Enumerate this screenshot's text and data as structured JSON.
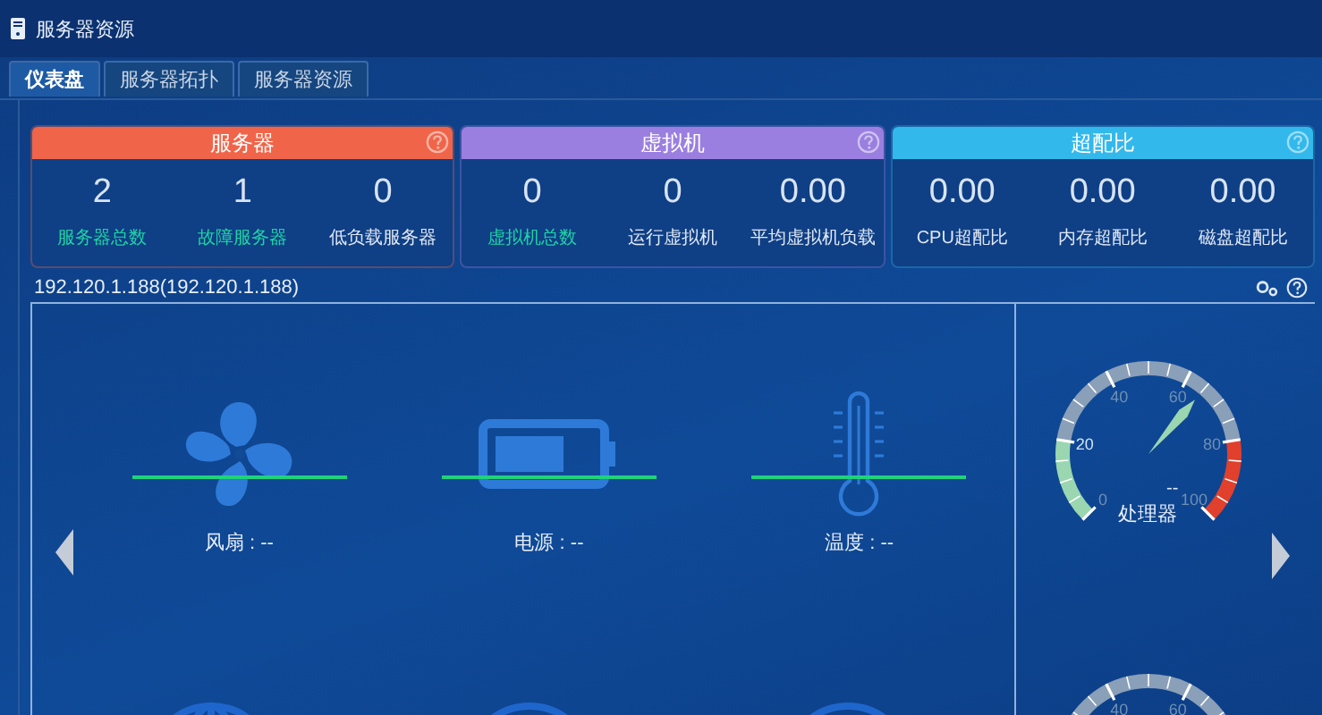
{
  "window": {
    "title": "服务器资源"
  },
  "tabs": [
    {
      "label": "仪表盘",
      "selected": true
    },
    {
      "label": "服务器拓扑",
      "selected": false
    },
    {
      "label": "服务器资源",
      "selected": false
    }
  ],
  "summary_cards": [
    {
      "title": "服务器",
      "color": "#f0654a",
      "stats": [
        {
          "value": "2",
          "label": "服务器总数",
          "highlight": true
        },
        {
          "value": "1",
          "label": "故障服务器",
          "highlight": true
        },
        {
          "value": "0",
          "label": "低负载服务器",
          "highlight": false
        }
      ]
    },
    {
      "title": "虚拟机",
      "color": "#9a7fe0",
      "stats": [
        {
          "value": "0",
          "label": "虚拟机总数",
          "highlight": true
        },
        {
          "value": "0",
          "label": "运行虚拟机",
          "highlight": false
        },
        {
          "value": "0.00",
          "label": "平均虚拟机负载",
          "highlight": false
        }
      ]
    },
    {
      "title": "超配比",
      "color": "#33b8ec",
      "stats": [
        {
          "value": "0.00",
          "label": "CPU超配比",
          "highlight": false
        },
        {
          "value": "0.00",
          "label": "内存超配比",
          "highlight": false
        },
        {
          "value": "0.00",
          "label": "磁盘超配比",
          "highlight": false
        }
      ]
    }
  ],
  "detail": {
    "host": "192.120.1.188(192.120.1.188)",
    "sensors": [
      {
        "kind": "fan",
        "label": "风扇 : --"
      },
      {
        "kind": "battery",
        "label": "电源 : --"
      },
      {
        "kind": "thermometer",
        "label": "温度 : --"
      }
    ],
    "gauges": [
      {
        "ticks": [
          "0",
          "20",
          "40",
          "60",
          "80",
          "100"
        ],
        "value": "--",
        "level": 0.65,
        "label": "处理器"
      },
      {
        "ticks": [
          "40",
          "60"
        ]
      }
    ]
  }
}
